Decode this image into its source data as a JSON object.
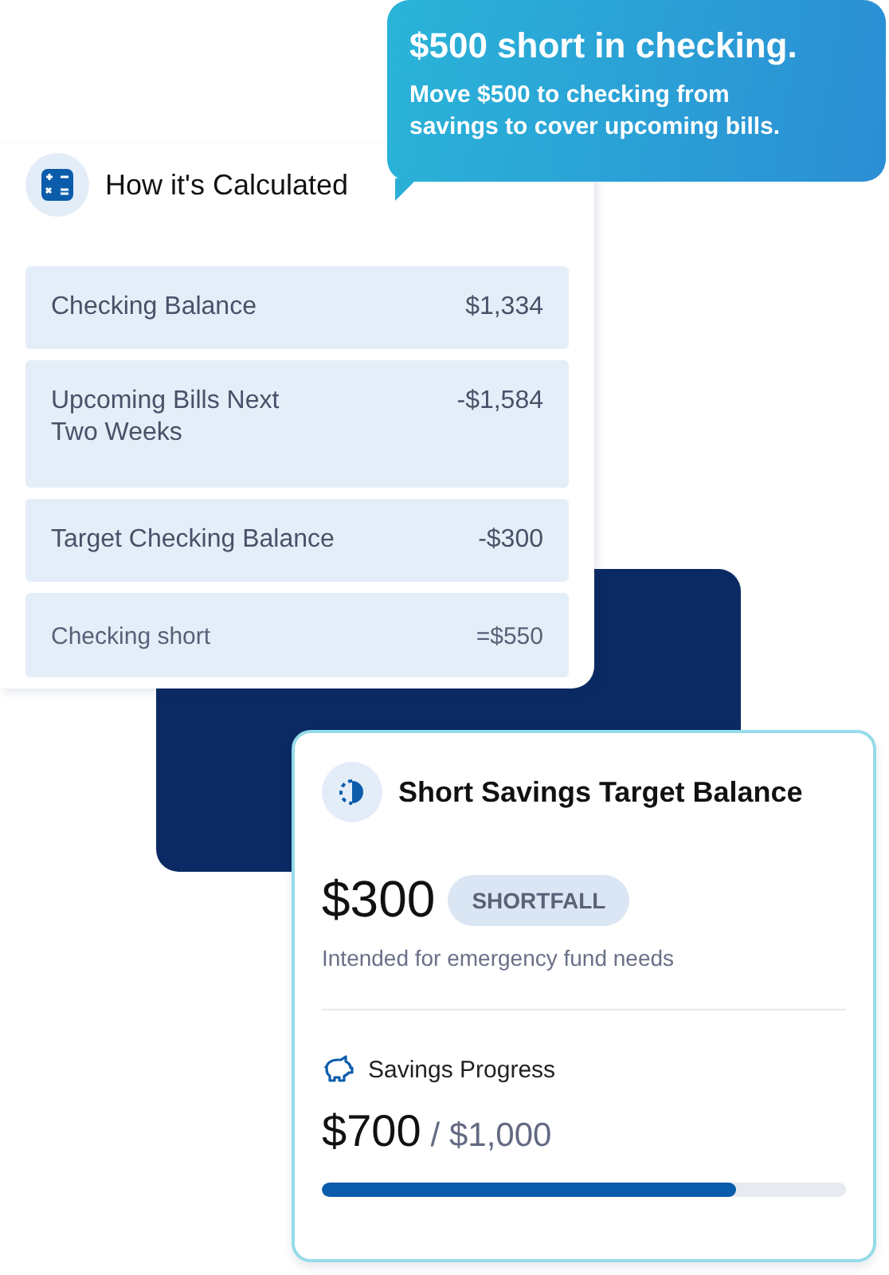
{
  "alert": {
    "title": "$500 short in checking.",
    "message": "Move $500 to checking from savings to cover upcoming bills."
  },
  "calculation": {
    "title": "How it's Calculated",
    "rows": [
      {
        "label": "Checking Balance",
        "value": "$1,334",
        "kind": "item"
      },
      {
        "label": "Upcoming Bills Next\nTwo Weeks",
        "value": "-$1,584",
        "kind": "item"
      },
      {
        "label": "Target Checking Balance",
        "value": "-$300",
        "kind": "item"
      },
      {
        "label": "Checking short",
        "value": "=$550",
        "kind": "total"
      }
    ]
  },
  "savings_card": {
    "title": "Short Savings Target Balance",
    "amount": "$300",
    "badge": "SHORTFALL",
    "description": "Intended for emergency fund needs",
    "progress": {
      "label": "Savings Progress",
      "current": "$700",
      "target": "/ $1,000",
      "level": 0.79
    }
  }
}
